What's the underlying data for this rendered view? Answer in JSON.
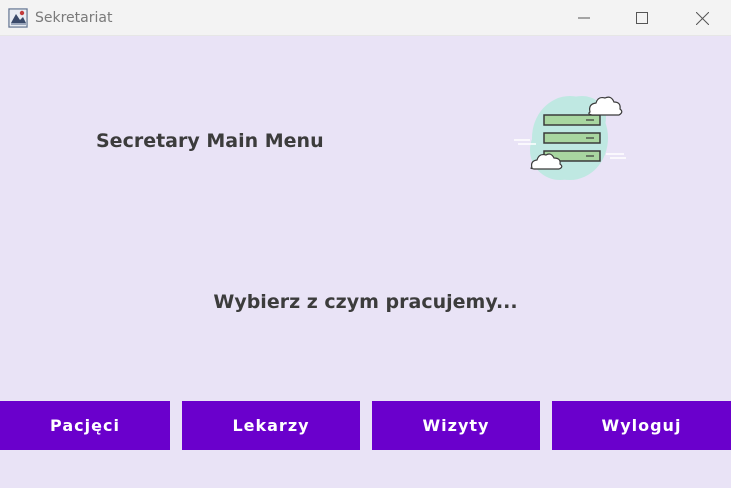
{
  "window": {
    "title": "Sekretariat",
    "controls": {
      "minimize_icon": "minimize-icon",
      "maximize_icon": "maximize-icon",
      "close_icon": "close-icon"
    }
  },
  "main": {
    "heading": "Secretary Main Menu",
    "illustration_icon": "server-stack-clouds-icon",
    "prompt": "Wybierz z czym pracujemy..."
  },
  "buttons": [
    {
      "label": "Pacjęci"
    },
    {
      "label": "Lekarzy"
    },
    {
      "label": "Wizyty"
    },
    {
      "label": "Wyloguj"
    }
  ],
  "colors": {
    "background": "#e9e3f6",
    "button": "#6a00cc",
    "button_text": "#ffffff",
    "heading_text": "#3c3c3c",
    "titlebar": "#f3f3f3"
  }
}
